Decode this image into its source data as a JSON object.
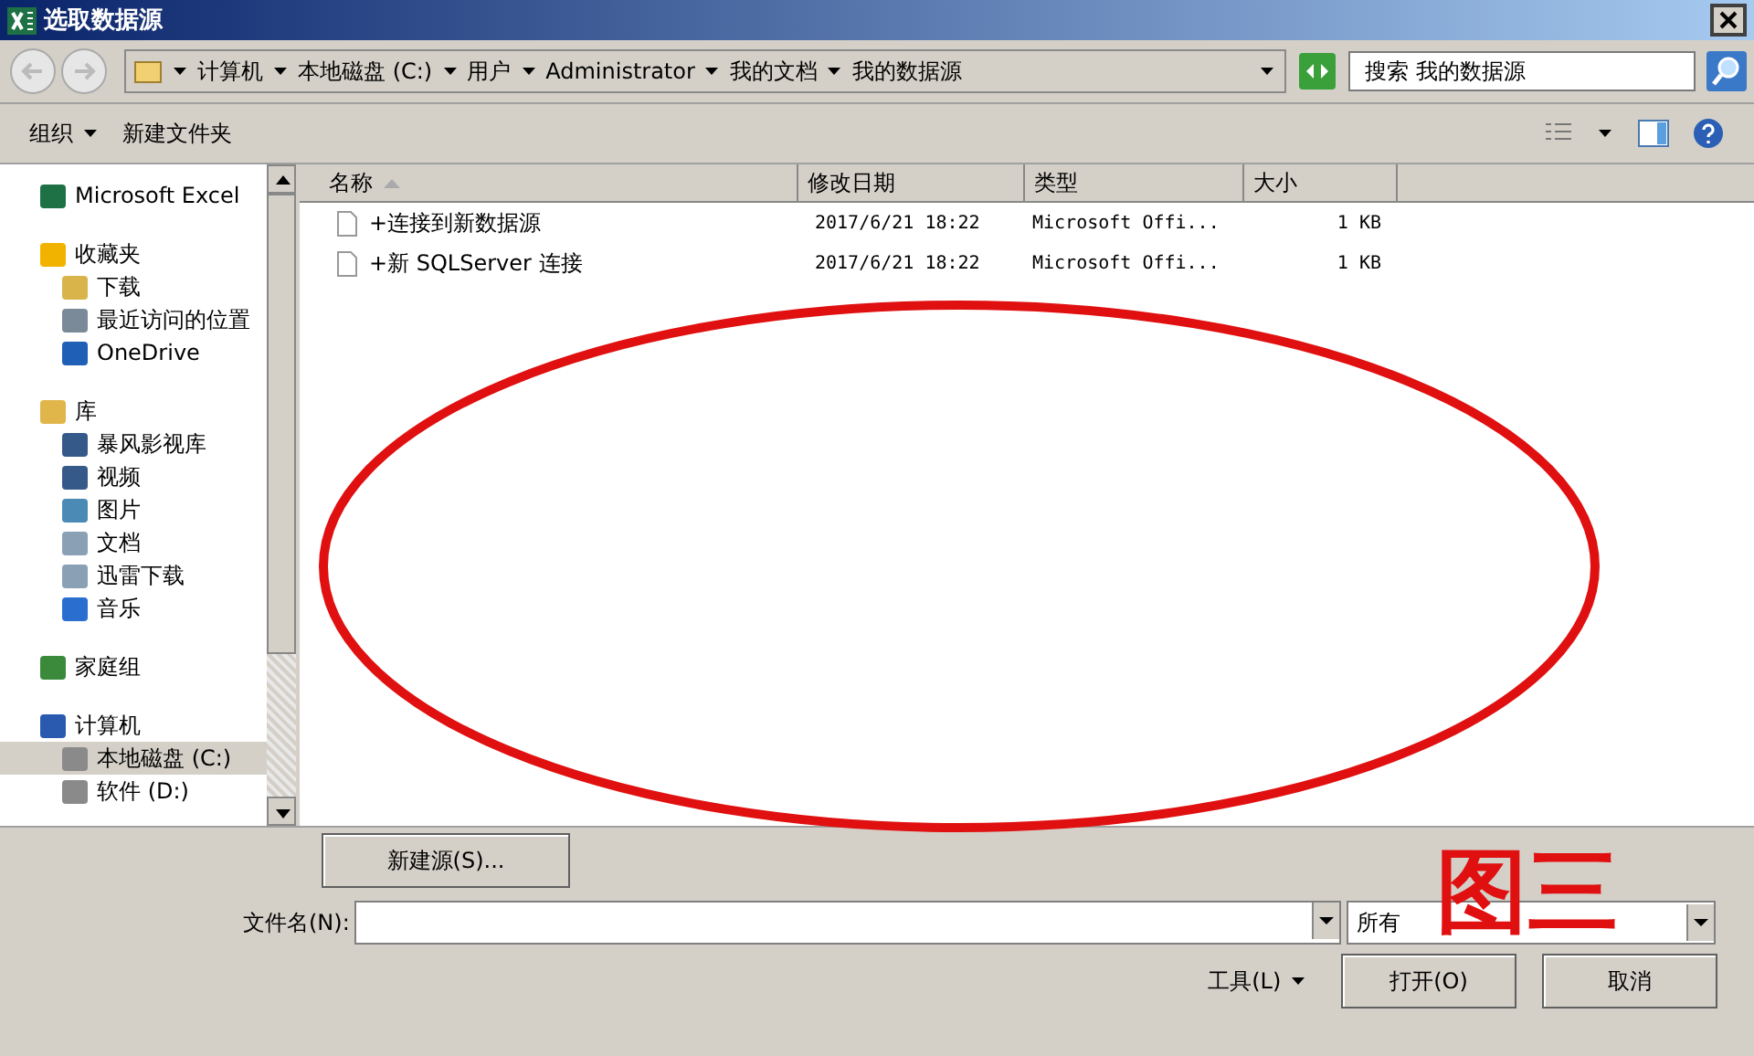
{
  "window": {
    "title": "选取数据源"
  },
  "address": {
    "crumbs": [
      "计算机",
      "本地磁盘 (C:)",
      "用户",
      "Administrator",
      "我的文档",
      "我的数据源"
    ]
  },
  "search": {
    "placeholder": "搜索 我的数据源"
  },
  "toolbar": {
    "organize": "组织",
    "new_folder": "新建文件夹"
  },
  "sidebar": {
    "items": [
      {
        "label": "Microsoft Excel",
        "kind": "app",
        "selected": false
      },
      {
        "label": "收藏夹",
        "kind": "star",
        "selected": false,
        "children": [
          {
            "label": "下载",
            "kind": "download",
            "selected": false
          },
          {
            "label": "最近访问的位置",
            "kind": "recent",
            "selected": false
          },
          {
            "label": "OneDrive",
            "kind": "cloud",
            "selected": false
          }
        ]
      },
      {
        "label": "库",
        "kind": "library",
        "selected": false,
        "children": [
          {
            "label": "暴风影视库",
            "kind": "video",
            "selected": false
          },
          {
            "label": "视频",
            "kind": "video",
            "selected": false
          },
          {
            "label": "图片",
            "kind": "image",
            "selected": false
          },
          {
            "label": "文档",
            "kind": "doc",
            "selected": false
          },
          {
            "label": "迅雷下载",
            "kind": "doc",
            "selected": false
          },
          {
            "label": "音乐",
            "kind": "music",
            "selected": false
          }
        ]
      },
      {
        "label": "家庭组",
        "kind": "network",
        "selected": false
      },
      {
        "label": "计算机",
        "kind": "computer",
        "selected": false,
        "children": [
          {
            "label": "本地磁盘 (C:)",
            "kind": "drive",
            "selected": true
          },
          {
            "label": "软件 (D:)",
            "kind": "drive",
            "selected": false
          }
        ]
      }
    ]
  },
  "table": {
    "columns": [
      "名称",
      "修改日期",
      "类型",
      "大小"
    ],
    "rows": [
      {
        "name": "+连接到新数据源",
        "date": "2017/6/21 18:22",
        "type": "Microsoft Offi...",
        "size": "1 KB"
      },
      {
        "name": "+新 SQLServer 连接",
        "date": "2017/6/21 18:22",
        "type": "Microsoft Offi...",
        "size": "1 KB"
      }
    ]
  },
  "new_source_button": "新建源(S)...",
  "filename": {
    "label": "文件名(N):"
  },
  "filetype": {
    "value": "所有"
  },
  "tools": "工具(L)",
  "buttons": [
    "打开(O)",
    "取消"
  ],
  "annotation": {
    "label": "图三"
  }
}
